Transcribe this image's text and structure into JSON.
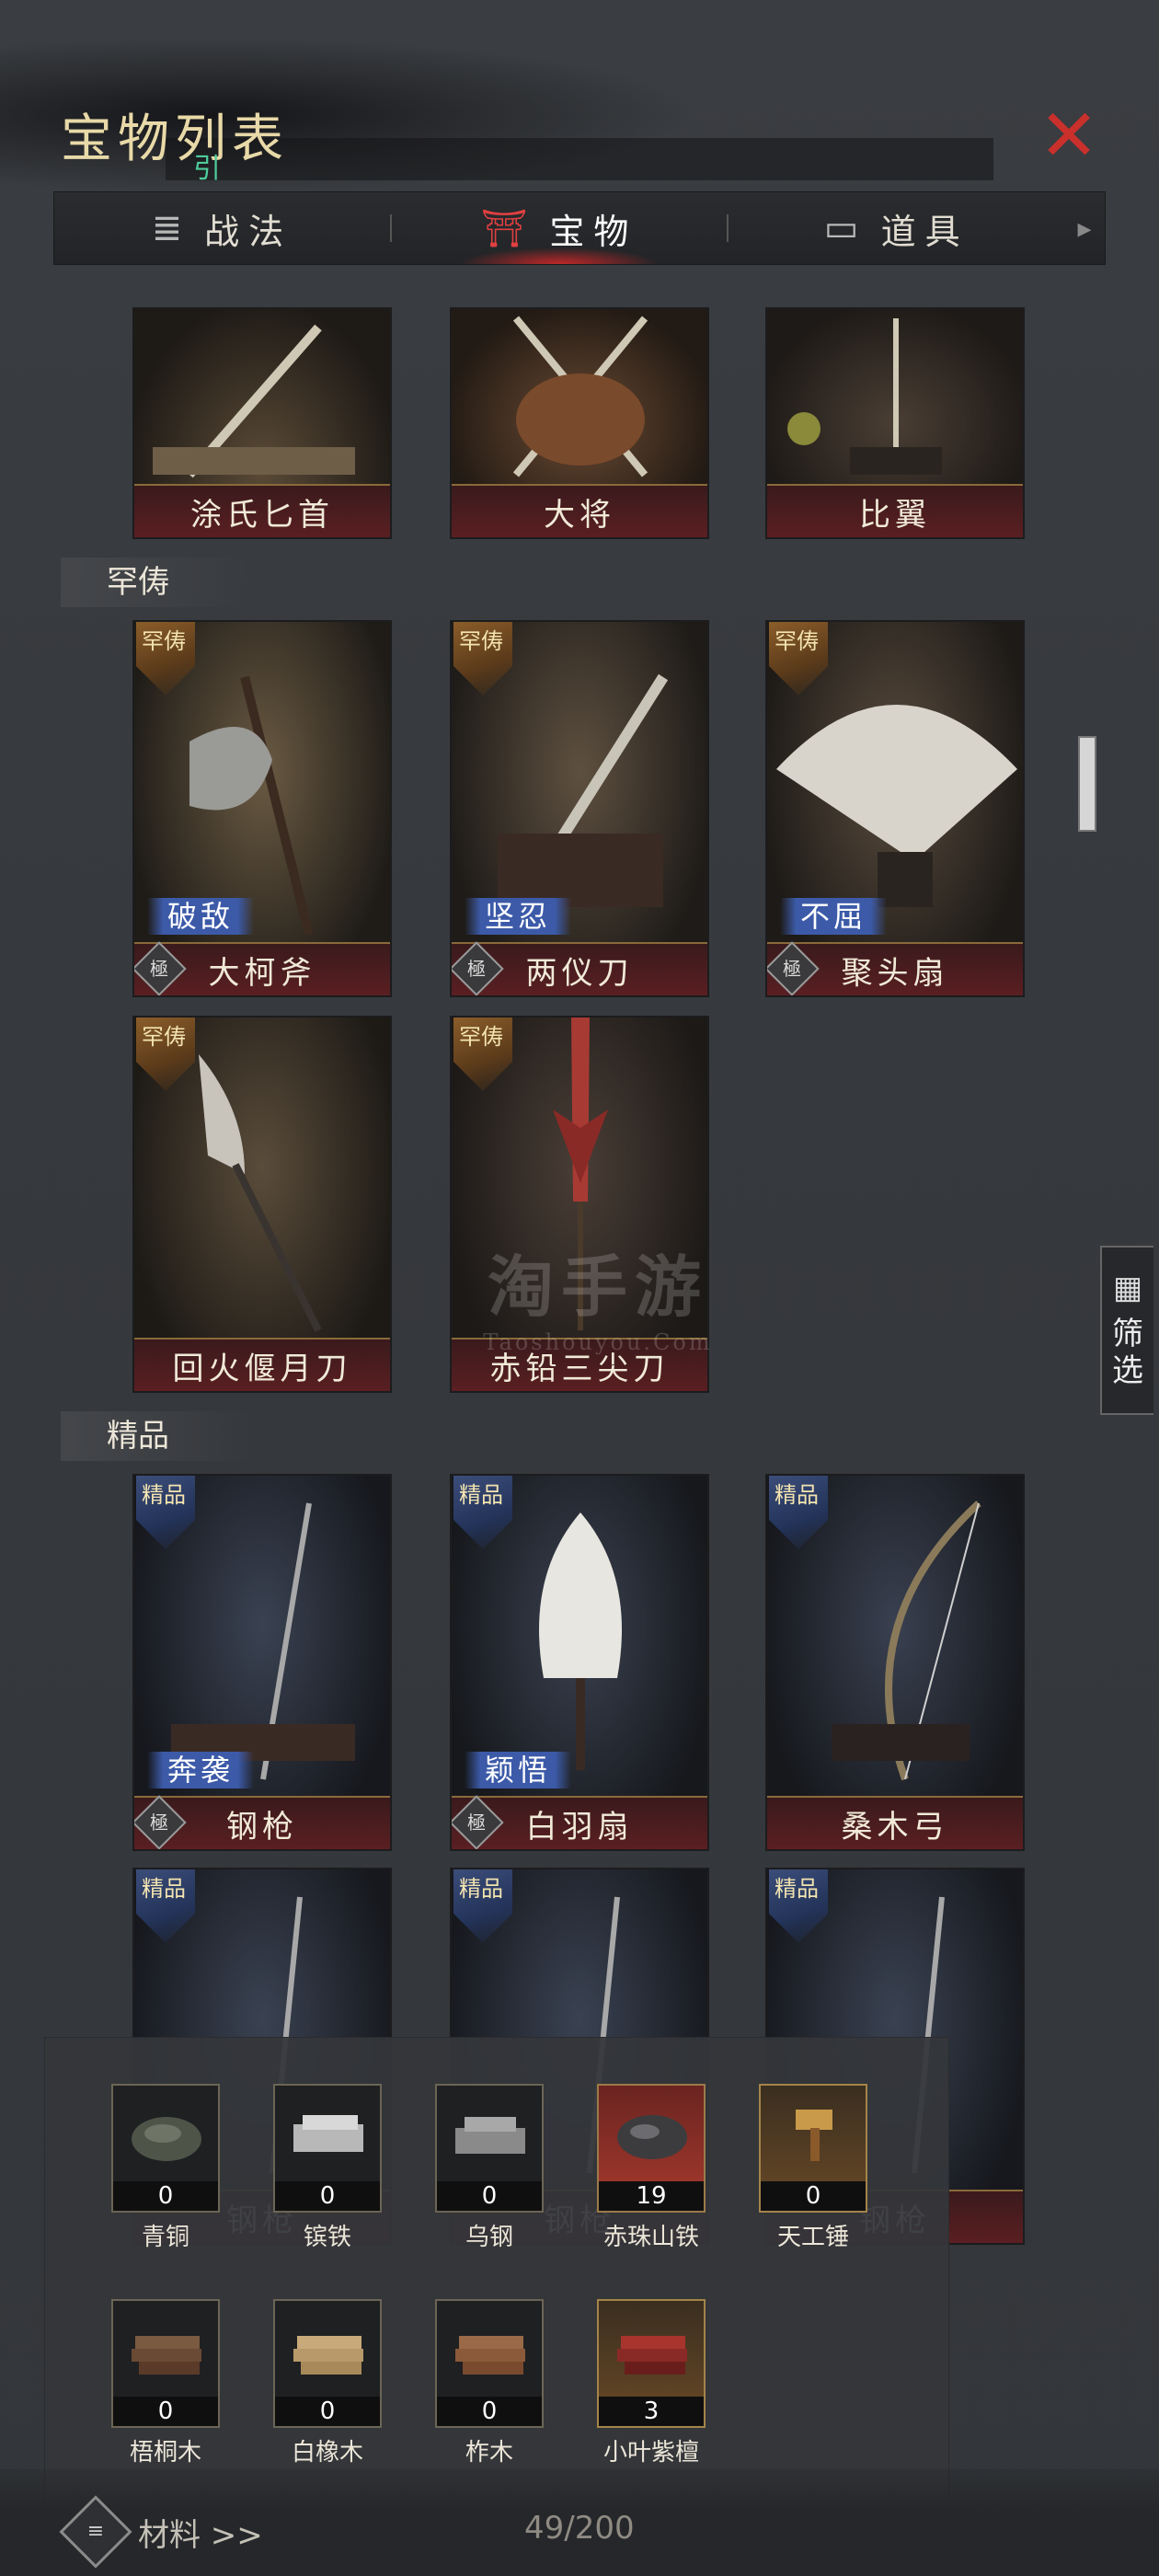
{
  "header": {
    "title": "宝物列表",
    "subtitle": "引",
    "close_icon": "close-x-icon"
  },
  "tabs": [
    {
      "label": "战法",
      "icon": "scroll-icon",
      "active": false
    },
    {
      "label": "宝物",
      "icon": "treasure-icon",
      "active": true
    },
    {
      "label": "道具",
      "icon": "box-icon",
      "active": false
    }
  ],
  "top_row": [
    {
      "name": "涂氏匕首"
    },
    {
      "name": "大将"
    },
    {
      "name": "比翼"
    }
  ],
  "sections": {
    "rare": {
      "label": "罕俦",
      "badge": "罕俦"
    },
    "fine": {
      "label": "精品",
      "badge": "精品"
    }
  },
  "rare_items": [
    {
      "name": "大柯斧",
      "skill": "破敌",
      "grade": "極"
    },
    {
      "name": "两仪刀",
      "skill": "坚忍",
      "grade": "極"
    },
    {
      "name": "聚头扇",
      "skill": "不屈",
      "grade": "極"
    },
    {
      "name": "回火偃月刀"
    },
    {
      "name": "赤铅三尖刀"
    }
  ],
  "fine_items": [
    {
      "name": "钢枪",
      "skill": "奔袭",
      "grade": "極"
    },
    {
      "name": "白羽扇",
      "skill": "颖悟",
      "grade": "極"
    },
    {
      "name": "桑木弓"
    },
    {
      "name": "钢枪"
    },
    {
      "name": "钢枪"
    },
    {
      "name": "钢枪"
    }
  ],
  "filter": {
    "label": "筛选",
    "icon": "grid-icon"
  },
  "watermark": {
    "big": "淘手游",
    "small": "Taoshouyou.Com"
  },
  "materials": [
    {
      "name": "青铜",
      "qty": "0"
    },
    {
      "name": "镔铁",
      "qty": "0"
    },
    {
      "name": "乌钢",
      "qty": "0"
    },
    {
      "name": "赤珠山铁",
      "qty": "19"
    },
    {
      "name": "天工锤",
      "qty": "0"
    },
    {
      "name": "梧桐木",
      "qty": "0"
    },
    {
      "name": "白橡木",
      "qty": "0"
    },
    {
      "name": "柞木",
      "qty": "0"
    },
    {
      "name": "小叶紫檀",
      "qty": "3"
    }
  ],
  "footer": {
    "materials_link": "材料 >>",
    "count": "49/200"
  },
  "colors": {
    "accent_red": "#c9302c",
    "name_bar": "#5a1f22",
    "skill_blue": "#3c5aa8",
    "rare_gold": "#8b5d2a",
    "fine_blue": "#3b4d7a"
  }
}
